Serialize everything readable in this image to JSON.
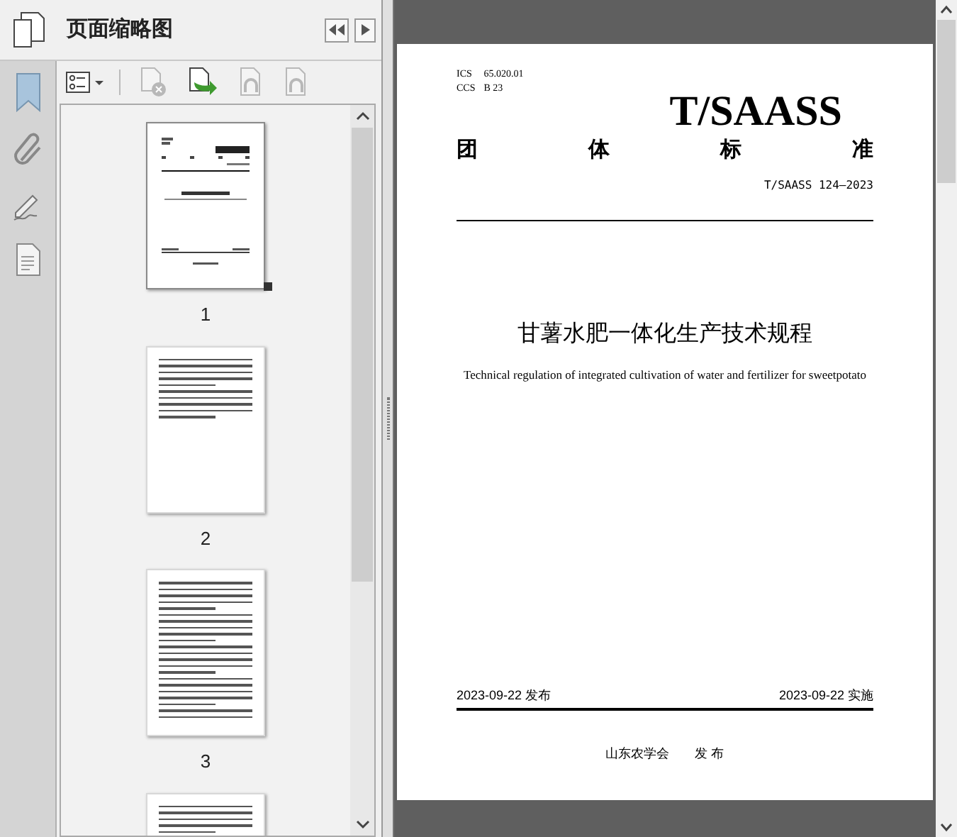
{
  "panel": {
    "title": "页面缩略图"
  },
  "toolbar": [
    {
      "kind": "options",
      "disabled": false
    },
    {
      "kind": "delete",
      "disabled": true
    },
    {
      "kind": "insert",
      "disabled": false
    },
    {
      "kind": "undo",
      "disabled": true
    },
    {
      "kind": "redo",
      "disabled": true
    }
  ],
  "thumbnails": [
    {
      "label": "1",
      "kind": "cover",
      "selected": true
    },
    {
      "label": "2",
      "kind": "foreword",
      "selected": false
    },
    {
      "label": "3",
      "kind": "text",
      "selected": false
    },
    {
      "kind": "text",
      "selected": false
    }
  ],
  "document": {
    "ics": "ICS",
    "ics_code": "65.020.01",
    "ccs": "CCS",
    "ccs_code": "B 23",
    "logo": "T/SAASS",
    "category": [
      "团",
      "体",
      "标",
      "准"
    ],
    "number": "T/SAASS 124—2023",
    "title": "甘薯水肥一体化生产技术规程",
    "subtitle": "Technical regulation of integrated cultivation of water and fertilizer for sweetpotato",
    "issued": "2023-09-22 发布",
    "effective": "2023-09-22 实施",
    "publisher": "山东农学会　　发 布"
  }
}
